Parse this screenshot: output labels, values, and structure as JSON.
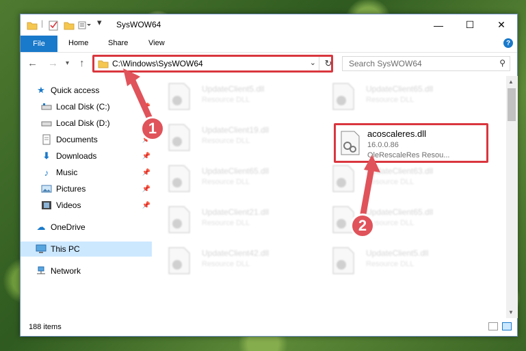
{
  "window": {
    "title": "SysWOW64",
    "controls": {
      "minimize": "—",
      "maximize": "☐",
      "close": "✕"
    }
  },
  "ribbon": {
    "file_tab": "File",
    "tabs": [
      "Home",
      "Share",
      "View"
    ],
    "help_icon": "?"
  },
  "navigation": {
    "back_icon": "back-arrow-icon",
    "forward_icon": "forward-arrow-icon",
    "address_path": "C:\\Windows\\SysWOW64",
    "search_placeholder": "Search SysWOW64"
  },
  "sidebar": {
    "items": [
      {
        "label": "Quick access",
        "icon": "star-icon"
      },
      {
        "label": "Local Disk (C:)",
        "icon": "drive-icon",
        "pinned": true
      },
      {
        "label": "Local Disk (D:)",
        "icon": "drive-icon",
        "pinned": true
      },
      {
        "label": "Documents",
        "icon": "documents-icon",
        "pinned": true
      },
      {
        "label": "Downloads",
        "icon": "download-icon",
        "pinned": true
      },
      {
        "label": "Music",
        "icon": "music-icon",
        "pinned": true
      },
      {
        "label": "Pictures",
        "icon": "pictures-icon",
        "pinned": true
      },
      {
        "label": "Videos",
        "icon": "videos-icon",
        "pinned": true
      },
      {
        "label": "OneDrive",
        "icon": "cloud-icon"
      },
      {
        "label": "This PC",
        "icon": "computer-icon",
        "selected": true
      },
      {
        "label": "Network",
        "icon": "network-icon"
      }
    ]
  },
  "files": [
    {
      "name": "UpdateClient5.dll",
      "type": "Resource DLL"
    },
    {
      "name": "UpdateClient65.dll",
      "type": "Resource DLL"
    },
    {
      "name": "UpdateClient19.dll",
      "type": "Resource DLL"
    },
    {
      "name": "UpdateClient65.dll",
      "type": "Resource DLL"
    },
    {
      "name": "UpdateClient63.dll",
      "type": "Resource DLL"
    },
    {
      "name": "UpdateClient21.dll",
      "type": "Resource DLL"
    },
    {
      "name": "UpdateClient65.dll",
      "type": "Resource DLL"
    },
    {
      "name": "UpdateClient42.dll",
      "type": "Resource DLL"
    },
    {
      "name": "UpdateClient5.dll",
      "type": "Resource DLL"
    }
  ],
  "highlighted_file": {
    "name": "acoscaleres.dll",
    "version": "16.0.0.86",
    "description": "OleRescaleRes Resou..."
  },
  "status": {
    "item_count": "188 items"
  },
  "callouts": [
    "1",
    "2"
  ],
  "colors": {
    "accent": "#1979ca",
    "highlight": "#d9363e",
    "callout": "#e0535a",
    "selected": "#cce8ff"
  }
}
